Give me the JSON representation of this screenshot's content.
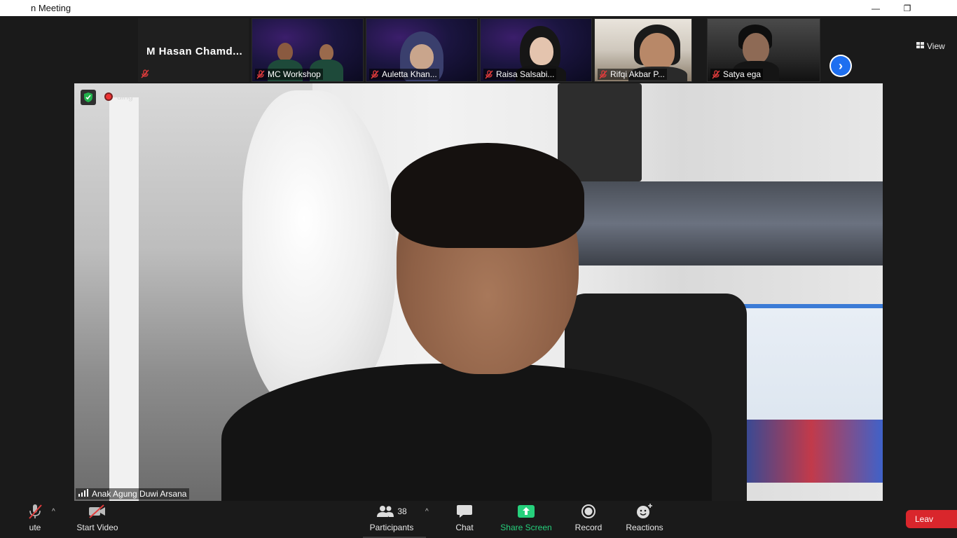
{
  "window": {
    "title": "n Meeting",
    "minimize_glyph": "—",
    "restore_glyph": "❐"
  },
  "strip": {
    "featured_name": "M  Hasan  Chamd...",
    "participants": [
      {
        "name": "MC Workshop"
      },
      {
        "name": "Auletta Khan..."
      },
      {
        "name": "Raisa Salsabi..."
      },
      {
        "name": "Rifqi Akbar P..."
      },
      {
        "name": "Satya ega"
      }
    ],
    "next_glyph": "›",
    "view_label": "View"
  },
  "main": {
    "recording_label": "ding",
    "speaker_name": "Anak Agung Duwi Arsana"
  },
  "toolbar": {
    "mute_label": "ute",
    "start_video_label": "Start Video",
    "participants_label": "Participants",
    "participants_count": "38",
    "chat_label": "Chat",
    "share_label": "Share Screen",
    "record_label": "Record",
    "reactions_label": "Reactions",
    "leave_label": "Leav",
    "caret_glyph": "^"
  },
  "colors": {
    "accent_blue": "#1e6ff0",
    "share_green": "#26d07c",
    "leave_red": "#d9262c",
    "muted_red": "#e23c3c"
  }
}
